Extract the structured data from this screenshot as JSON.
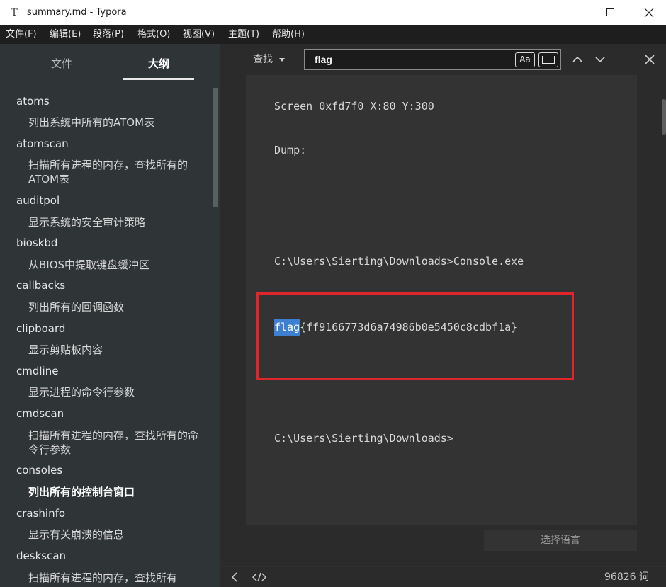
{
  "window": {
    "title": "summary.md - Typora",
    "logo_letter": "T"
  },
  "menu": [
    "文件(F)",
    "编辑(E)",
    "段落(P)",
    "格式(O)",
    "视图(V)",
    "主题(T)",
    "帮助(H)"
  ],
  "sidebar": {
    "tab_files": "文件",
    "tab_outline": "大纲",
    "outline": [
      {
        "text": "atoms",
        "level": 1
      },
      {
        "text": "列出系统中所有的ATOM表",
        "level": 2
      },
      {
        "text": "atomscan",
        "level": 1
      },
      {
        "text": "扫描所有进程的内存，查找所有的ATOM表",
        "level": 2
      },
      {
        "text": "auditpol",
        "level": 1
      },
      {
        "text": "显示系统的安全审计策略",
        "level": 2
      },
      {
        "text": "bioskbd",
        "level": 1
      },
      {
        "text": "从BIOS中提取键盘缓冲区",
        "level": 2
      },
      {
        "text": "callbacks",
        "level": 1
      },
      {
        "text": "列出所有的回调函数",
        "level": 2
      },
      {
        "text": "clipboard",
        "level": 1
      },
      {
        "text": "显示剪贴板内容",
        "level": 2
      },
      {
        "text": "cmdline",
        "level": 1
      },
      {
        "text": "显示进程的命令行参数",
        "level": 2
      },
      {
        "text": "cmdscan",
        "level": 1
      },
      {
        "text": "扫描所有进程的内存，查找所有的命令行参数",
        "level": 2
      },
      {
        "text": "consoles",
        "level": 1
      },
      {
        "text": "列出所有的控制台窗口",
        "level": 2,
        "active": true
      },
      {
        "text": "crashinfo",
        "level": 1
      },
      {
        "text": "显示有关崩溃的信息",
        "level": 2
      },
      {
        "text": "deskscan",
        "level": 1
      },
      {
        "text": "扫描所有进程的内存，查找所有",
        "level": 2
      }
    ]
  },
  "find": {
    "label": "查找",
    "query": "flag",
    "case_label": "Aa"
  },
  "code": {
    "line_screen": "Screen 0xfd7f0 X:80 Y:300",
    "line_dump": "Dump:",
    "line_cmd": "C:\\Users\\Sierting\\Downloads>Console.exe",
    "flag_match": "flag",
    "flag_rest": "{ff9166773d6a74986b0e5450c8cdbf1a}",
    "line_prompt": "C:\\Users\\Sierting\\Downloads>"
  },
  "code_language_placeholder": "选择语言",
  "status": {
    "word_count": "96826 词"
  },
  "colors": {
    "highlight": "#3d7fd1",
    "annotation_red": "#e0262d"
  }
}
